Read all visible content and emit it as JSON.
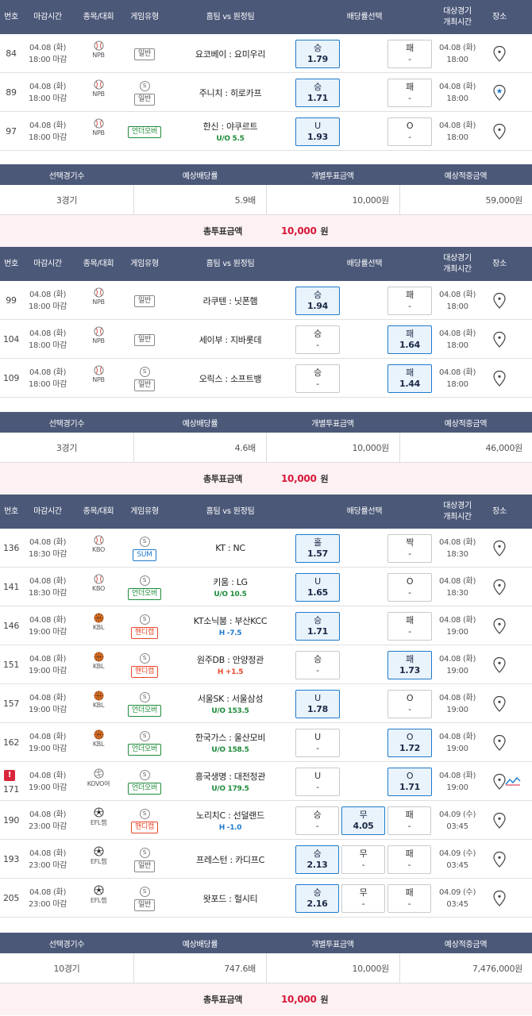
{
  "header": {
    "num": "번호",
    "deadline": "마감시간",
    "sport": "종목/대회",
    "type": "게임유형",
    "teams": "홈팀 vs 원정팀",
    "odds": "배당률선택",
    "schedule_l1": "대상경기",
    "schedule_l2": "개최시간",
    "venue": "장소"
  },
  "summary_header": {
    "count": "선택경기수",
    "odds": "예상배당률",
    "stake": "개별투표금액",
    "payout": "예상적중금액"
  },
  "total_label": "총투표금액",
  "colors": {
    "header_bg": "#4b5878",
    "selected_bg": "#e9f3fc",
    "selected_border": "#1f7acb",
    "total_bg": "#fdf1f3",
    "total_value": "#d8183a",
    "over_under": "#1e8b3a",
    "handicap": "#e8492b"
  },
  "groups": [
    {
      "rows": [
        {
          "num": "84",
          "date": "04.08 (화)",
          "time": "18:00 마감",
          "league": "NPB",
          "sport": "baseball",
          "s": false,
          "type": "일반",
          "tcls": "b-normal",
          "teams": "요코베이 : 요미우리",
          "line": "",
          "lcls": "",
          "picks": [
            {
              "label": "승",
              "odd": "1.79",
              "sel": true,
              "slot": 0
            },
            {
              "label": "패",
              "odd": "-",
              "sel": false,
              "slot": 2
            }
          ],
          "sdate": "04.08 (화)",
          "stime": "18:00",
          "pin": "map-pin-icon"
        },
        {
          "num": "89",
          "date": "04.08 (화)",
          "time": "18:00 마감",
          "league": "NPB",
          "sport": "baseball",
          "s": true,
          "type": "일반",
          "tcls": "b-normal",
          "teams": "주니치 : 히로카프",
          "line": "",
          "lcls": "",
          "picks": [
            {
              "label": "승",
              "odd": "1.71",
              "sel": true,
              "slot": 0
            },
            {
              "label": "패",
              "odd": "-",
              "sel": false,
              "slot": 2
            }
          ],
          "sdate": "04.08 (화)",
          "stime": "18:00",
          "pin": "map-pin-star-icon"
        },
        {
          "num": "97",
          "date": "04.08 (화)",
          "time": "18:00 마감",
          "league": "NPB",
          "sport": "baseball",
          "s": false,
          "type": "언더오버",
          "tcls": "b-ou",
          "teams": "한신 : 야쿠르트",
          "line": "U/O 5.5",
          "lcls": "l-ou",
          "picks": [
            {
              "label": "U",
              "odd": "1.93",
              "sel": true,
              "slot": 0
            },
            {
              "label": "O",
              "odd": "-",
              "sel": false,
              "slot": 2
            }
          ],
          "sdate": "04.08 (화)",
          "stime": "18:00",
          "pin": "map-pin-icon"
        }
      ],
      "summary": {
        "count": "3경기",
        "odds": "5.9배",
        "stake": "10,000원",
        "payout": "59,000원"
      },
      "total": "10,000",
      "won": "원"
    },
    {
      "rows": [
        {
          "num": "99",
          "date": "04.08 (화)",
          "time": "18:00 마감",
          "league": "NPB",
          "sport": "baseball",
          "s": false,
          "type": "일반",
          "tcls": "b-normal",
          "teams": "라쿠텐 : 닛폰햄",
          "line": "",
          "lcls": "",
          "picks": [
            {
              "label": "승",
              "odd": "1.94",
              "sel": true,
              "slot": 0
            },
            {
              "label": "패",
              "odd": "-",
              "sel": false,
              "slot": 2
            }
          ],
          "sdate": "04.08 (화)",
          "stime": "18:00",
          "pin": "map-pin-icon"
        },
        {
          "num": "104",
          "date": "04.08 (화)",
          "time": "18:00 마감",
          "league": "NPB",
          "sport": "baseball",
          "s": false,
          "type": "일반",
          "tcls": "b-normal",
          "teams": "세이부 : 지바롯데",
          "line": "",
          "lcls": "",
          "picks": [
            {
              "label": "승",
              "odd": "-",
              "sel": false,
              "slot": 0
            },
            {
              "label": "패",
              "odd": "1.64",
              "sel": true,
              "slot": 2
            }
          ],
          "sdate": "04.08 (화)",
          "stime": "18:00",
          "pin": "map-pin-icon"
        },
        {
          "num": "109",
          "date": "04.08 (화)",
          "time": "18:00 마감",
          "league": "NPB",
          "sport": "baseball",
          "s": true,
          "type": "일반",
          "tcls": "b-normal",
          "teams": "오릭스 : 소프트뱅",
          "line": "",
          "lcls": "",
          "picks": [
            {
              "label": "승",
              "odd": "-",
              "sel": false,
              "slot": 0
            },
            {
              "label": "패",
              "odd": "1.44",
              "sel": true,
              "slot": 2
            }
          ],
          "sdate": "04.08 (화)",
          "stime": "18:00",
          "pin": "map-pin-icon"
        }
      ],
      "summary": {
        "count": "3경기",
        "odds": "4.6배",
        "stake": "10,000원",
        "payout": "46,000원"
      },
      "total": "10,000",
      "won": "원"
    },
    {
      "rows": [
        {
          "num": "136",
          "date": "04.08 (화)",
          "time": "18:30 마감",
          "league": "KBO",
          "sport": "baseball",
          "s": true,
          "type": "SUM",
          "tcls": "b-sum",
          "teams": "KT : NC",
          "line": "",
          "lcls": "",
          "picks": [
            {
              "label": "홀",
              "odd": "1.57",
              "sel": true,
              "slot": 0
            },
            {
              "label": "짝",
              "odd": "-",
              "sel": false,
              "slot": 2
            }
          ],
          "sdate": "04.08 (화)",
          "stime": "18:30",
          "pin": "map-pin-icon"
        },
        {
          "num": "141",
          "date": "04.08 (화)",
          "time": "18:30 마감",
          "league": "KBO",
          "sport": "baseball",
          "s": true,
          "type": "언더오버",
          "tcls": "b-ou",
          "teams": "키움 : LG",
          "line": "U/O 10.5",
          "lcls": "l-ou",
          "picks": [
            {
              "label": "U",
              "odd": "1.65",
              "sel": true,
              "slot": 0
            },
            {
              "label": "O",
              "odd": "-",
              "sel": false,
              "slot": 2
            }
          ],
          "sdate": "04.08 (화)",
          "stime": "18:30",
          "pin": "map-pin-icon"
        },
        {
          "num": "146",
          "date": "04.08 (화)",
          "time": "19:00 마감",
          "league": "KBL",
          "sport": "basketball",
          "s": true,
          "type": "핸디캡",
          "tcls": "b-hd",
          "teams": "KT소닉붐 : 부산KCC",
          "line": "H -7.5",
          "lcls": "l-h",
          "picks": [
            {
              "label": "승",
              "odd": "1.71",
              "sel": true,
              "slot": 0
            },
            {
              "label": "패",
              "odd": "-",
              "sel": false,
              "slot": 2
            }
          ],
          "sdate": "04.08 (화)",
          "stime": "19:00",
          "pin": "map-pin-icon"
        },
        {
          "num": "151",
          "date": "04.08 (화)",
          "time": "19:00 마감",
          "league": "KBL",
          "sport": "basketball",
          "s": true,
          "type": "핸디캡",
          "tcls": "b-hd",
          "teams": "원주DB : 안양정관",
          "line": "H +1.5",
          "lcls": "l-hd",
          "picks": [
            {
              "label": "승",
              "odd": "-",
              "sel": false,
              "slot": 0
            },
            {
              "label": "패",
              "odd": "1.73",
              "sel": true,
              "slot": 2
            }
          ],
          "sdate": "04.08 (화)",
          "stime": "19:00",
          "pin": "map-pin-icon"
        },
        {
          "num": "157",
          "date": "04.08 (화)",
          "time": "19:00 마감",
          "league": "KBL",
          "sport": "basketball",
          "s": true,
          "type": "언더오버",
          "tcls": "b-ou",
          "teams": "서울SK : 서울삼성",
          "line": "U/O 153.5",
          "lcls": "l-ou",
          "picks": [
            {
              "label": "U",
              "odd": "1.78",
              "sel": true,
              "slot": 0
            },
            {
              "label": "O",
              "odd": "-",
              "sel": false,
              "slot": 2
            }
          ],
          "sdate": "04.08 (화)",
          "stime": "19:00",
          "pin": "map-pin-icon"
        },
        {
          "num": "162",
          "date": "04.08 (화)",
          "time": "19:00 마감",
          "league": "KBL",
          "sport": "basketball",
          "s": true,
          "type": "언더오버",
          "tcls": "b-ou",
          "teams": "한국가스 : 울산모비",
          "line": "U/O 158.5",
          "lcls": "l-ou",
          "picks": [
            {
              "label": "U",
              "odd": "-",
              "sel": false,
              "slot": 0
            },
            {
              "label": "O",
              "odd": "1.72",
              "sel": true,
              "slot": 2
            }
          ],
          "sdate": "04.08 (화)",
          "stime": "19:00",
          "pin": "map-pin-icon"
        },
        {
          "num": "171",
          "date": "04.08 (화)",
          "time": "19:00 마감",
          "league": "KOVO여",
          "sport": "volleyball",
          "s": true,
          "type": "언더오버",
          "tcls": "b-ou",
          "teams": "흥국생명 : 대전정관",
          "line": "U/O 179.5",
          "lcls": "l-ou",
          "picks": [
            {
              "label": "U",
              "odd": "-",
              "sel": false,
              "slot": 0
            },
            {
              "label": "O",
              "odd": "1.71",
              "sel": true,
              "slot": 2
            }
          ],
          "sdate": "04.08 (화)",
          "stime": "19:00",
          "pin": "map-pin-icon"
        },
        {
          "num": "190",
          "date": "04.08 (화)",
          "time": "23:00 마감",
          "league": "EFL챔",
          "sport": "soccer",
          "s": true,
          "type": "핸디캡",
          "tcls": "b-hd",
          "teams": "노리치C : 선덜랜드",
          "line": "H -1.0",
          "lcls": "l-h",
          "picks": [
            {
              "label": "승",
              "odd": "-",
              "sel": false,
              "slot": 0
            },
            {
              "label": "무",
              "odd": "4.05",
              "sel": true,
              "slot": 1
            },
            {
              "label": "패",
              "odd": "-",
              "sel": false,
              "slot": 2
            }
          ],
          "sdate": "04.09 (수)",
          "stime": "03:45",
          "pin": "map-pin-icon"
        },
        {
          "num": "193",
          "date": "04.08 (화)",
          "time": "23:00 마감",
          "league": "EFL챔",
          "sport": "soccer",
          "s": true,
          "type": "일반",
          "tcls": "b-normal",
          "teams": "프레스턴 : 카디프C",
          "line": "",
          "lcls": "",
          "picks": [
            {
              "label": "승",
              "odd": "2.13",
              "sel": true,
              "slot": 0
            },
            {
              "label": "무",
              "odd": "-",
              "sel": false,
              "slot": 1
            },
            {
              "label": "패",
              "odd": "-",
              "sel": false,
              "slot": 2
            }
          ],
          "sdate": "04.09 (수)",
          "stime": "03:45",
          "pin": "map-pin-icon"
        },
        {
          "num": "205",
          "date": "04.08 (화)",
          "time": "23:00 마감",
          "league": "EFL챔",
          "sport": "soccer",
          "s": true,
          "type": "일반",
          "tcls": "b-normal",
          "teams": "왓포드 : 헐시티",
          "line": "",
          "lcls": "",
          "picks": [
            {
              "label": "승",
              "odd": "2.16",
              "sel": true,
              "slot": 0
            },
            {
              "label": "무",
              "odd": "-",
              "sel": false,
              "slot": 1
            },
            {
              "label": "패",
              "odd": "-",
              "sel": false,
              "slot": 2
            }
          ],
          "sdate": "04.09 (수)",
          "stime": "03:45",
          "pin": "map-pin-icon"
        }
      ],
      "summary": {
        "count": "10경기",
        "odds": "747.6배",
        "stake": "10,000원",
        "payout": "7,476,000원"
      },
      "total": "10,000",
      "won": "원"
    }
  ],
  "alert_row": {
    "icon": "alert-icon",
    "symbol": "!",
    "extra_icon": "trend-chart-icon"
  }
}
